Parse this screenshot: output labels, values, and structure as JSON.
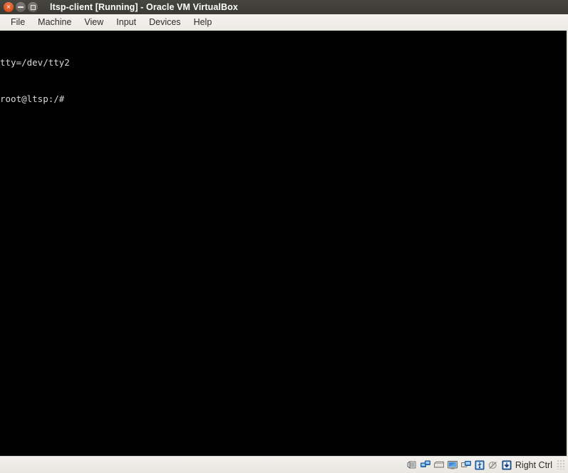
{
  "window": {
    "title": "ltsp-client [Running] - Oracle VM VirtualBox",
    "buttons": [
      {
        "name": "close",
        "label": "×"
      },
      {
        "name": "minimize",
        "label": ""
      },
      {
        "name": "maximize",
        "label": ""
      }
    ],
    "colors": {
      "titlebar_bg": "#3f3e3a",
      "titlebar_fg": "#ffffff",
      "menubar_bg": "#f1efec",
      "guest_bg": "#000000",
      "guest_fg": "#d8d8d8",
      "statusbar_bg": "#efede8",
      "close_button": "#d9521e"
    }
  },
  "menubar": {
    "items": [
      {
        "label": "File"
      },
      {
        "label": "Machine"
      },
      {
        "label": "View"
      },
      {
        "label": "Input"
      },
      {
        "label": "Devices"
      },
      {
        "label": "Help"
      }
    ]
  },
  "guest": {
    "lines": [
      "tty=/dev/tty2",
      "root@ltsp:/#"
    ]
  },
  "statusbar": {
    "icons": [
      {
        "name": "hard-disk-icon",
        "title": "Hard Disks"
      },
      {
        "name": "network-icon",
        "title": "Network"
      },
      {
        "name": "removable-media-icon",
        "title": "Removable Media"
      },
      {
        "name": "display-icon",
        "title": "Display"
      },
      {
        "name": "shared-folders-icon",
        "title": "Shared Folders"
      },
      {
        "name": "usb-icon",
        "title": "USB Devices"
      },
      {
        "name": "mouse-icon",
        "title": "Mouse Integration"
      },
      {
        "name": "host-key-icon",
        "title": "Host Key"
      }
    ],
    "host_key_label": "Right Ctrl"
  }
}
